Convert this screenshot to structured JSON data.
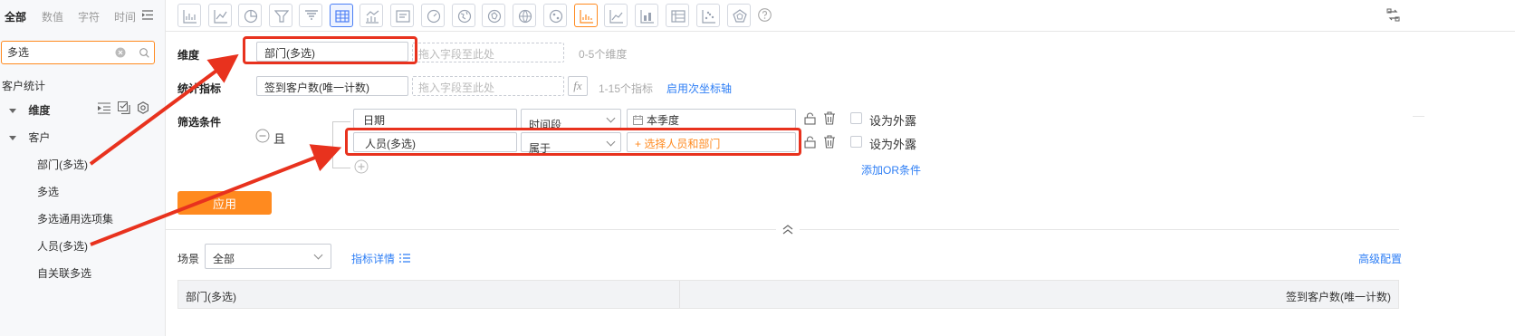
{
  "filter_tabs": [
    "全部",
    "数值",
    "字符",
    "时间"
  ],
  "search": {
    "value": "多选"
  },
  "tree": {
    "group": "客户统计",
    "dimension_node": "维度",
    "customer_node": "客户",
    "items": [
      "部门(多选)",
      "多选",
      "多选通用选项集",
      "人员(多选)",
      "自关联多选"
    ]
  },
  "config": {
    "dimension_label": "维度",
    "dimension_value": "部门(多选)",
    "drop_placeholder": "拖入字段至此处",
    "dimension_hint": "0-5个维度",
    "metric_label": "统计指标",
    "metric_value": "签到客户数(唯一计数)",
    "metric_hint": "1-15个指标",
    "secondary_axis": "启用次坐标轴",
    "fx": "fx"
  },
  "filter": {
    "label": "筛选条件",
    "logic": "且",
    "rows": [
      {
        "field": "日期",
        "operator": "时间段",
        "value": "本季度",
        "expose": "设为外露"
      },
      {
        "field": "人员(多选)",
        "operator": "属于",
        "value": "+ 选择人员和部门",
        "expose": "设为外露"
      }
    ],
    "add_or": "添加OR条件"
  },
  "apply_label": "应用",
  "scene": {
    "label": "场景",
    "value": "全部",
    "metric_detail": "指标详情",
    "advanced": "高级配置"
  },
  "table": {
    "columns": [
      "部门(多选)",
      "签到客户数(唯一计数)"
    ]
  },
  "colors": {
    "accent": "#ff8a1f",
    "link": "#2d7ef5",
    "annotation": "#e8321e"
  }
}
